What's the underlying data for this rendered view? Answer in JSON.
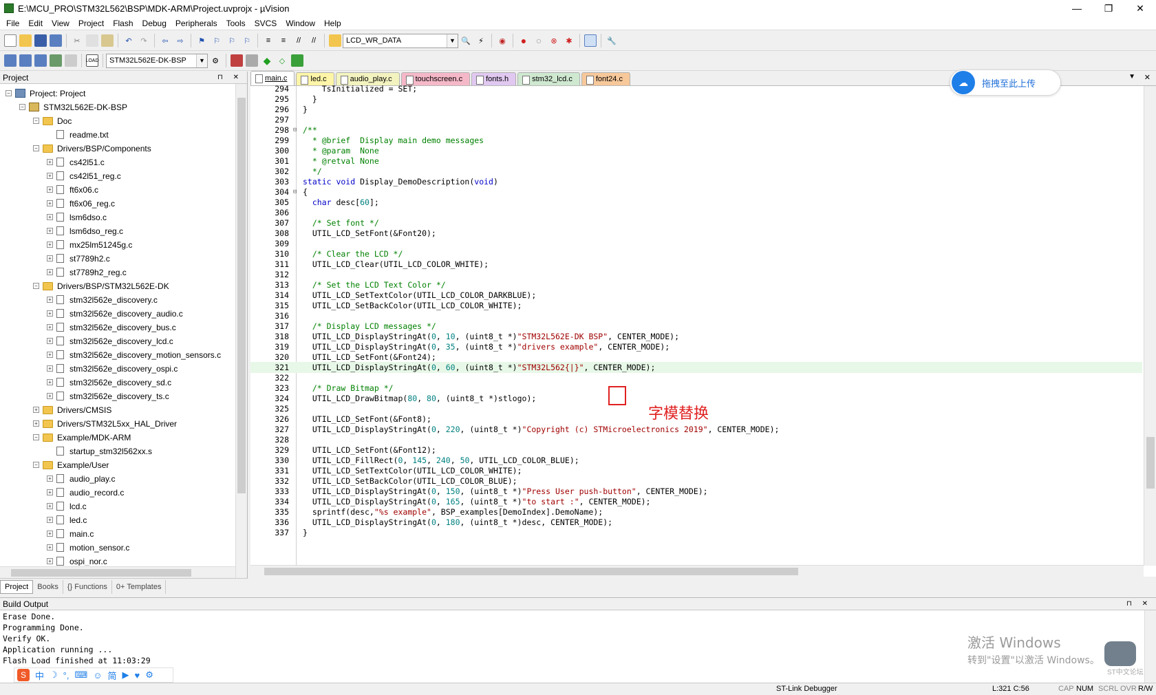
{
  "window": {
    "title": "E:\\MCU_PRO\\STM32L562\\BSP\\MDK-ARM\\Project.uvprojx - µVision",
    "minimize": "—",
    "restore": "❐",
    "close": "✕"
  },
  "menu": [
    "File",
    "Edit",
    "View",
    "Project",
    "Flash",
    "Debug",
    "Peripherals",
    "Tools",
    "SVCS",
    "Window",
    "Help"
  ],
  "toolbar": {
    "find_combo": "LCD_WR_DATA",
    "target_combo": "STM32L562E-DK-BSP"
  },
  "project_panel": {
    "title": "Project",
    "pins": "⊓ ✕",
    "tree": [
      {
        "label": "Project: Project",
        "level": 0,
        "type": "project",
        "exp": "−"
      },
      {
        "label": "STM32L562E-DK-BSP",
        "level": 1,
        "type": "target",
        "exp": "−"
      },
      {
        "label": "Doc",
        "level": 2,
        "type": "folder",
        "exp": "−"
      },
      {
        "label": "readme.txt",
        "level": 3,
        "type": "file",
        "exp": ""
      },
      {
        "label": "Drivers/BSP/Components",
        "level": 2,
        "type": "folder",
        "exp": "−"
      },
      {
        "label": "cs42l51.c",
        "level": 3,
        "type": "file",
        "exp": "+"
      },
      {
        "label": "cs42l51_reg.c",
        "level": 3,
        "type": "file",
        "exp": "+"
      },
      {
        "label": "ft6x06.c",
        "level": 3,
        "type": "file",
        "exp": "+"
      },
      {
        "label": "ft6x06_reg.c",
        "level": 3,
        "type": "file",
        "exp": "+"
      },
      {
        "label": "lsm6dso.c",
        "level": 3,
        "type": "file",
        "exp": "+"
      },
      {
        "label": "lsm6dso_reg.c",
        "level": 3,
        "type": "file",
        "exp": "+"
      },
      {
        "label": "mx25lm51245g.c",
        "level": 3,
        "type": "file",
        "exp": "+"
      },
      {
        "label": "st7789h2.c",
        "level": 3,
        "type": "file",
        "exp": "+"
      },
      {
        "label": "st7789h2_reg.c",
        "level": 3,
        "type": "file",
        "exp": "+"
      },
      {
        "label": "Drivers/BSP/STM32L562E-DK",
        "level": 2,
        "type": "folder",
        "exp": "−"
      },
      {
        "label": "stm32l562e_discovery.c",
        "level": 3,
        "type": "file",
        "exp": "+"
      },
      {
        "label": "stm32l562e_discovery_audio.c",
        "level": 3,
        "type": "file",
        "exp": "+"
      },
      {
        "label": "stm32l562e_discovery_bus.c",
        "level": 3,
        "type": "file",
        "exp": "+"
      },
      {
        "label": "stm32l562e_discovery_lcd.c",
        "level": 3,
        "type": "file",
        "exp": "+"
      },
      {
        "label": "stm32l562e_discovery_motion_sensors.c",
        "level": 3,
        "type": "file",
        "exp": "+"
      },
      {
        "label": "stm32l562e_discovery_ospi.c",
        "level": 3,
        "type": "file",
        "exp": "+"
      },
      {
        "label": "stm32l562e_discovery_sd.c",
        "level": 3,
        "type": "file",
        "exp": "+"
      },
      {
        "label": "stm32l562e_discovery_ts.c",
        "level": 3,
        "type": "file",
        "exp": "+"
      },
      {
        "label": "Drivers/CMSIS",
        "level": 2,
        "type": "folder",
        "exp": "+"
      },
      {
        "label": "Drivers/STM32L5xx_HAL_Driver",
        "level": 2,
        "type": "folder",
        "exp": "+"
      },
      {
        "label": "Example/MDK-ARM",
        "level": 2,
        "type": "folder",
        "exp": "−"
      },
      {
        "label": "startup_stm32l562xx.s",
        "level": 3,
        "type": "file",
        "exp": ""
      },
      {
        "label": "Example/User",
        "level": 2,
        "type": "folder",
        "exp": "−"
      },
      {
        "label": "audio_play.c",
        "level": 3,
        "type": "file",
        "exp": "+"
      },
      {
        "label": "audio_record.c",
        "level": 3,
        "type": "file",
        "exp": "+"
      },
      {
        "label": "lcd.c",
        "level": 3,
        "type": "file",
        "exp": "+"
      },
      {
        "label": "led.c",
        "level": 3,
        "type": "file",
        "exp": "+"
      },
      {
        "label": "main.c",
        "level": 3,
        "type": "file",
        "exp": "+"
      },
      {
        "label": "motion_sensor.c",
        "level": 3,
        "type": "file",
        "exp": "+"
      },
      {
        "label": "ospi_nor.c",
        "level": 3,
        "type": "file",
        "exp": "+"
      }
    ],
    "tabs": [
      "Project",
      "Books",
      "{} Functions",
      "0+ Templates"
    ]
  },
  "editor": {
    "tabs": [
      {
        "label": "main.c",
        "color": "#ffffff",
        "active": true
      },
      {
        "label": "led.c",
        "color": "#fff5a8",
        "active": false
      },
      {
        "label": "audio_play.c",
        "color": "#f3f3c0",
        "active": false
      },
      {
        "label": "touchscreen.c",
        "color": "#f5b8c8",
        "active": false
      },
      {
        "label": "fonts.h",
        "color": "#e0c8f0",
        "active": false
      },
      {
        "label": "stm32_lcd.c",
        "color": "#cfe8d0",
        "active": false
      },
      {
        "label": "font24.c",
        "color": "#f7c89a",
        "active": false
      }
    ],
    "tab_menu": "▼",
    "tab_close": "✕",
    "lines": [
      {
        "n": "294",
        "f": "",
        "t": [
          [
            "    TsInitialized = SET;",
            ""
          ]
        ]
      },
      {
        "n": "295",
        "f": "",
        "t": [
          [
            "  }",
            ""
          ]
        ]
      },
      {
        "n": "296",
        "f": "",
        "t": [
          [
            "}",
            ""
          ]
        ]
      },
      {
        "n": "297",
        "f": "",
        "t": [
          [
            "",
            ""
          ]
        ]
      },
      {
        "n": "298",
        "f": "⊟",
        "t": [
          [
            "/**",
            "cm"
          ]
        ]
      },
      {
        "n": "299",
        "f": "",
        "t": [
          [
            "  * @brief  Display main demo messages",
            "cm"
          ]
        ]
      },
      {
        "n": "300",
        "f": "",
        "t": [
          [
            "  * @param  None",
            "cm"
          ]
        ]
      },
      {
        "n": "301",
        "f": "",
        "t": [
          [
            "  * @retval None",
            "cm"
          ]
        ]
      },
      {
        "n": "302",
        "f": "",
        "t": [
          [
            "  */",
            "cm"
          ]
        ]
      },
      {
        "n": "303",
        "f": "",
        "t": [
          [
            "static void",
            "kw"
          ],
          [
            " Display_DemoDescription(",
            ""
          ],
          [
            "void",
            "kw"
          ],
          [
            ")",
            ""
          ]
        ]
      },
      {
        "n": "304",
        "f": "⊟",
        "t": [
          [
            "{",
            ""
          ]
        ]
      },
      {
        "n": "305",
        "f": "",
        "t": [
          [
            "  ",
            ""
          ],
          [
            "char",
            "kw"
          ],
          [
            " desc[",
            ""
          ],
          [
            "60",
            "num"
          ],
          [
            "];",
            ""
          ]
        ]
      },
      {
        "n": "306",
        "f": "",
        "t": [
          [
            "",
            ""
          ]
        ]
      },
      {
        "n": "307",
        "f": "",
        "t": [
          [
            "  /* Set font */",
            "cm"
          ]
        ]
      },
      {
        "n": "308",
        "f": "",
        "t": [
          [
            "  UTIL_LCD_SetFont(&Font20);",
            ""
          ]
        ]
      },
      {
        "n": "309",
        "f": "",
        "t": [
          [
            "",
            ""
          ]
        ]
      },
      {
        "n": "310",
        "f": "",
        "t": [
          [
            "  /* Clear the LCD */",
            "cm"
          ]
        ]
      },
      {
        "n": "311",
        "f": "",
        "t": [
          [
            "  UTIL_LCD_Clear(UTIL_LCD_COLOR_WHITE);",
            ""
          ]
        ]
      },
      {
        "n": "312",
        "f": "",
        "t": [
          [
            "",
            ""
          ]
        ]
      },
      {
        "n": "313",
        "f": "",
        "t": [
          [
            "  /* Set the LCD Text Color */",
            "cm"
          ]
        ]
      },
      {
        "n": "314",
        "f": "",
        "t": [
          [
            "  UTIL_LCD_SetTextColor(UTIL_LCD_COLOR_DARKBLUE);",
            ""
          ]
        ]
      },
      {
        "n": "315",
        "f": "",
        "t": [
          [
            "  UTIL_LCD_SetBackColor(UTIL_LCD_COLOR_WHITE);",
            ""
          ]
        ]
      },
      {
        "n": "316",
        "f": "",
        "t": [
          [
            "",
            ""
          ]
        ]
      },
      {
        "n": "317",
        "f": "",
        "t": [
          [
            "  /* Display LCD messages */",
            "cm"
          ]
        ]
      },
      {
        "n": "318",
        "f": "",
        "t": [
          [
            "  UTIL_LCD_DisplayStringAt(",
            ""
          ],
          [
            "0",
            "num"
          ],
          [
            ", ",
            ""
          ],
          [
            "10",
            "num"
          ],
          [
            ", (uint8_t *)",
            ""
          ],
          [
            "\"STM32L562E-DK BSP\"",
            "str"
          ],
          [
            ", CENTER_MODE);",
            ""
          ]
        ]
      },
      {
        "n": "319",
        "f": "",
        "t": [
          [
            "  UTIL_LCD_DisplayStringAt(",
            ""
          ],
          [
            "0",
            "num"
          ],
          [
            ", ",
            ""
          ],
          [
            "35",
            "num"
          ],
          [
            ", (uint8_t *)",
            ""
          ],
          [
            "\"drivers example\"",
            "str"
          ],
          [
            ", CENTER_MODE);",
            ""
          ]
        ]
      },
      {
        "n": "320",
        "f": "",
        "t": [
          [
            "  UTIL_LCD_SetFont(&Font24);",
            ""
          ]
        ]
      },
      {
        "n": "321",
        "f": "",
        "t": [
          [
            "  UTIL_LCD_DisplayStringAt(",
            ""
          ],
          [
            "0",
            "num"
          ],
          [
            ", ",
            ""
          ],
          [
            "60",
            "num"
          ],
          [
            ", (uint8_t *)",
            ""
          ],
          [
            "\"STM32L562{|}\"",
            "str"
          ],
          [
            ", CENTER_MODE);",
            ""
          ]
        ],
        "current": true
      },
      {
        "n": "322",
        "f": "",
        "t": [
          [
            "",
            ""
          ]
        ]
      },
      {
        "n": "323",
        "f": "",
        "t": [
          [
            "  /* Draw Bitmap */",
            "cm"
          ]
        ]
      },
      {
        "n": "324",
        "f": "",
        "t": [
          [
            "  UTIL_LCD_DrawBitmap(",
            ""
          ],
          [
            "80",
            "num"
          ],
          [
            ", ",
            ""
          ],
          [
            "80",
            "num"
          ],
          [
            ", (uint8_t *)stlogo);",
            ""
          ]
        ]
      },
      {
        "n": "325",
        "f": "",
        "t": [
          [
            "",
            ""
          ]
        ]
      },
      {
        "n": "326",
        "f": "",
        "t": [
          [
            "  UTIL_LCD_SetFont(&Font8);",
            ""
          ]
        ]
      },
      {
        "n": "327",
        "f": "",
        "t": [
          [
            "  UTIL_LCD_DisplayStringAt(",
            ""
          ],
          [
            "0",
            "num"
          ],
          [
            ", ",
            ""
          ],
          [
            "220",
            "num"
          ],
          [
            ", (uint8_t *)",
            ""
          ],
          [
            "\"Copyright (c) STMicroelectronics 2019\"",
            "str"
          ],
          [
            ", CENTER_MODE);",
            ""
          ]
        ]
      },
      {
        "n": "328",
        "f": "",
        "t": [
          [
            "",
            ""
          ]
        ]
      },
      {
        "n": "329",
        "f": "",
        "t": [
          [
            "  UTIL_LCD_SetFont(&Font12);",
            ""
          ]
        ]
      },
      {
        "n": "330",
        "f": "",
        "t": [
          [
            "  UTIL_LCD_FillRect(",
            ""
          ],
          [
            "0",
            "num"
          ],
          [
            ", ",
            ""
          ],
          [
            "145",
            "num"
          ],
          [
            ", ",
            ""
          ],
          [
            "240",
            "num"
          ],
          [
            ", ",
            ""
          ],
          [
            "50",
            "num"
          ],
          [
            ", UTIL_LCD_COLOR_BLUE);",
            ""
          ]
        ]
      },
      {
        "n": "331",
        "f": "",
        "t": [
          [
            "  UTIL_LCD_SetTextColor(UTIL_LCD_COLOR_WHITE);",
            ""
          ]
        ]
      },
      {
        "n": "332",
        "f": "",
        "t": [
          [
            "  UTIL_LCD_SetBackColor(UTIL_LCD_COLOR_BLUE);",
            ""
          ]
        ]
      },
      {
        "n": "333",
        "f": "",
        "t": [
          [
            "  UTIL_LCD_DisplayStringAt(",
            ""
          ],
          [
            "0",
            "num"
          ],
          [
            ", ",
            ""
          ],
          [
            "150",
            "num"
          ],
          [
            ", (uint8_t *)",
            ""
          ],
          [
            "\"Press User push-button\"",
            "str"
          ],
          [
            ", CENTER_MODE);",
            ""
          ]
        ]
      },
      {
        "n": "334",
        "f": "",
        "t": [
          [
            "  UTIL_LCD_DisplayStringAt(",
            ""
          ],
          [
            "0",
            "num"
          ],
          [
            ", ",
            ""
          ],
          [
            "165",
            "num"
          ],
          [
            ", (uint8_t *)",
            ""
          ],
          [
            "\"to start :\"",
            "str"
          ],
          [
            ", CENTER_MODE);",
            ""
          ]
        ]
      },
      {
        "n": "335",
        "f": "",
        "t": [
          [
            "  sprintf(desc,",
            ""
          ],
          [
            "\"%s example\"",
            "str"
          ],
          [
            ", BSP_examples[DemoIndex].DemoName);",
            ""
          ]
        ]
      },
      {
        "n": "336",
        "f": "",
        "t": [
          [
            "  UTIL_LCD_DisplayStringAt(",
            ""
          ],
          [
            "0",
            "num"
          ],
          [
            ", ",
            ""
          ],
          [
            "180",
            "num"
          ],
          [
            ", (uint8_t *)desc, CENTER_MODE);",
            ""
          ]
        ]
      },
      {
        "n": "337",
        "f": "",
        "t": [
          [
            "}",
            ""
          ]
        ]
      }
    ],
    "annotation": "字模替换"
  },
  "upload_widget": {
    "label": "拖拽至此上传",
    "icon": "cloud-icon"
  },
  "build_output": {
    "title": "Build Output",
    "pins": "⊓ ✕",
    "lines": [
      "Erase Done.",
      "Programming Done.",
      "Verify OK.",
      "Application running ...",
      "Flash Load finished at 11:03:29"
    ]
  },
  "watermark": {
    "line1": "激活 Windows",
    "line2": "转到\"设置\"以激活 Windows。"
  },
  "ime": {
    "badge": "S",
    "items": [
      "中",
      "☽",
      "°,",
      "⌨",
      "☺",
      "简",
      "▶",
      "♥",
      "⚙"
    ]
  },
  "chat_badge": "ST中文论坛",
  "status": {
    "debugger": "ST-Link Debugger",
    "position": "L:321 C:56",
    "caps": "CAP",
    "num": "NUM",
    "scrl": "SCRL",
    "ovr": "OVR",
    "rw": "R/W"
  },
  "colors": {
    "comment": "#008000",
    "keyword": "#0000c8",
    "string": "#a00000",
    "number": "#008080",
    "annotation": "#e02020",
    "upload_blue": "#1f7fe8"
  }
}
